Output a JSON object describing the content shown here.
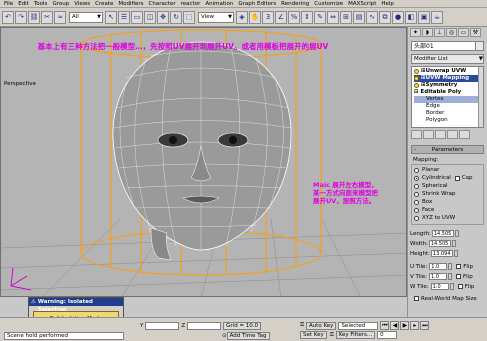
{
  "menu": [
    "File",
    "Edit",
    "Tools",
    "Group",
    "Views",
    "Create",
    "Modifiers",
    "Character",
    "reactor",
    "Animation",
    "Graph Editors",
    "Rendering",
    "Customize",
    "MAXScript",
    "Help"
  ],
  "toolbar": {
    "selection_filter": "All",
    "coord_system": "View"
  },
  "viewport": {
    "label": "Perspective",
    "annotation_top": "基本上有三种方法把一般模型…，先按照UV展开到展开UV。或者用模板把展开的展UV",
    "annotation_right": "Maic 展开左右模型，某一方式向面来模型把展开UV，按照方法。"
  },
  "panel": {
    "object_name": "头部01",
    "modifier_list": "Modifier List",
    "stack": [
      {
        "label": "Unwrap UVW",
        "selected": false,
        "bold": true
      },
      {
        "label": "UVW Mapping",
        "selected": true,
        "bold": true
      },
      {
        "label": "Symmetry",
        "selected": false,
        "bold": true
      },
      {
        "label": "Editable Poly",
        "selected": false,
        "bold": true
      }
    ],
    "sub_objects": [
      "Vertex",
      "Edge",
      "Border",
      "Polygon"
    ],
    "rollout_title": "Parameters",
    "mapping_label": "Mapping:",
    "mapping_options": [
      {
        "label": "Planar",
        "checked": false
      },
      {
        "label": "Cylindrical",
        "checked": true,
        "cap": "Cap"
      },
      {
        "label": "Spherical",
        "checked": false
      },
      {
        "label": "Shrink Wrap",
        "checked": false
      },
      {
        "label": "Box",
        "checked": false
      },
      {
        "label": "Face",
        "checked": false
      },
      {
        "label": "XYZ to UVW",
        "checked": false
      }
    ],
    "length_label": "Length:",
    "length_value": "14.505",
    "width_label": "Width:",
    "width_value": "14.505",
    "height_label": "Height:",
    "height_value": "13.094",
    "tiles": [
      {
        "label": "U Tile:",
        "value": "1.0",
        "flip": "Flip"
      },
      {
        "label": "V Tile:",
        "value": "1.0",
        "flip": "Flip"
      },
      {
        "label": "W Tile:",
        "value": "1.0",
        "flip": "Flip"
      }
    ],
    "real_world": "Real-World Map Size"
  },
  "isolation": {
    "title": "Warning: Isolated Selection",
    "button": "Exit Isolation Mode"
  },
  "status": {
    "message": "Scene hold performed",
    "y_label": "Y",
    "z_label": "Z",
    "grid": "Grid = 10.0",
    "add_time_tag": "Add Time Tag",
    "auto_key": "Auto Key",
    "auto_key_value": "Selected",
    "set_key": "Set Key",
    "key_filters": "Key Filters...",
    "frame": "0"
  },
  "colors": {
    "annotation": "#e000e0",
    "gizmo": "#ff9d00",
    "mesh_line": "#ffffff",
    "selection": "#2b4a9e"
  }
}
